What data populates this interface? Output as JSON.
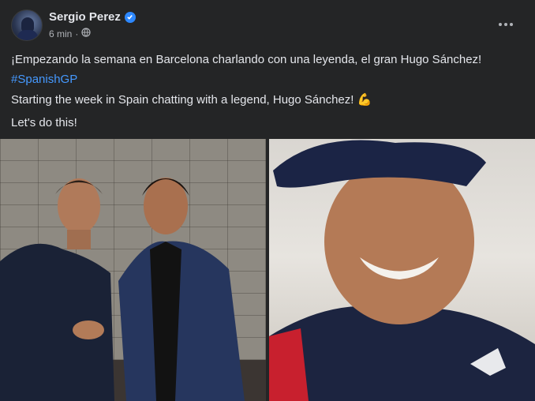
{
  "post": {
    "author": "Sergio Perez",
    "time": "6 min",
    "lines": {
      "spanish": "¡Empezando la semana en Barcelona charlando con una leyenda, el gran Hugo Sánchez!",
      "hashtag": "#SpanishGP",
      "english": "Starting the week in Spain chatting with a legend, Hugo Sánchez!",
      "emoji": "💪",
      "closing": "Let's do this!"
    }
  },
  "icons": {
    "verified": "verified-badge-icon",
    "audience": "globe-icon",
    "menu": "more-options-icon"
  },
  "colors": {
    "background": "#242526",
    "text": "#e4e6eb",
    "secondary_text": "#b0b3b8",
    "link": "#4599ff",
    "verified": "#2d88ff"
  }
}
